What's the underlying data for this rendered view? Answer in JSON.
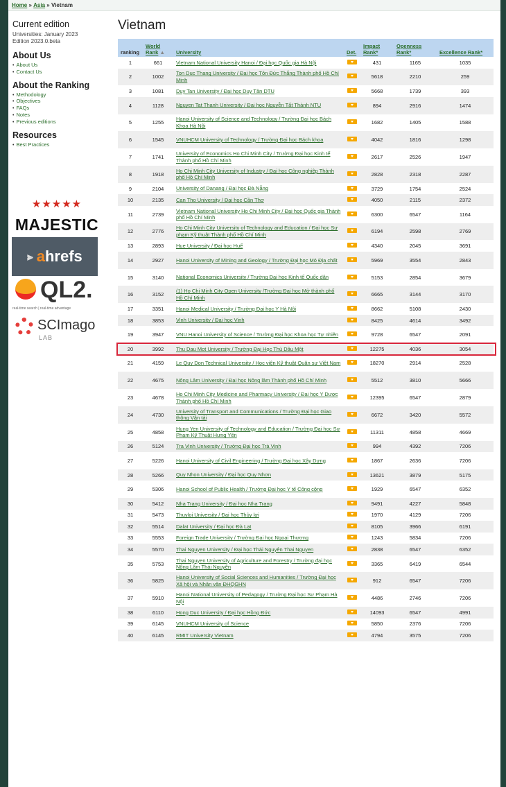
{
  "breadcrumb": {
    "home": "Home",
    "sep1": "»",
    "asia": "Asia",
    "sep2": "»",
    "current": "Vietnam"
  },
  "sidebar": {
    "current_edition": {
      "heading": "Current edition",
      "line1": "Universities: January 2023",
      "line2": "Edition 2023.0.beta"
    },
    "about_us": {
      "heading": "About Us",
      "items": [
        "About Us",
        "Contact Us"
      ]
    },
    "about_ranking": {
      "heading": "About the Ranking",
      "items": [
        "Methodology",
        "Objectives",
        "FAQs",
        "Notes",
        "Previous editions"
      ]
    },
    "resources": {
      "heading": "Resources",
      "items": [
        "Best Practices"
      ]
    }
  },
  "logos": {
    "majestic": "MAJESTIC",
    "ahrefs_a": "a",
    "ahrefs_rest": "hrefs",
    "ql2": "QL2.",
    "ql2_tagline": "real-time search | real-time advantage",
    "scimago": "SCImago",
    "scimago_lab": "LAB"
  },
  "main": {
    "title": "Vietnam",
    "columns": {
      "ranking": "ranking",
      "world_rank": "World Rank",
      "university": "University",
      "det": "Det.",
      "impact": "Impact Rank*",
      "openness": "Openness Rank*",
      "excellence": "Excellence Rank*"
    },
    "rows": [
      {
        "ranking": "1",
        "world": "661",
        "name": "Vietnam National University Hanoi / Đại học Quốc gia Hà Nội",
        "impact": "431",
        "openness": "1165",
        "excellence": "1035"
      },
      {
        "ranking": "2",
        "world": "1002",
        "name": "Ton Duc Thang University / Đại học Tôn Đức Thắng Thành phố Hồ Chí Minh",
        "impact": "5618",
        "openness": "2210",
        "excellence": "259"
      },
      {
        "ranking": "3",
        "world": "1081",
        "name": "Duy Tan University / Đại học Duy Tân DTU",
        "impact": "5668",
        "openness": "1739",
        "excellence": "393"
      },
      {
        "ranking": "4",
        "world": "1128",
        "name": "Nguyen Tat Thanh University / Đại học Nguyễn Tất Thành NTU",
        "impact": "894",
        "openness": "2916",
        "excellence": "1474"
      },
      {
        "ranking": "5",
        "world": "1255",
        "name": "Hanoi University of Science and Technology / Trường Đại học Bách Khoa Hà Nội",
        "impact": "1682",
        "openness": "1405",
        "excellence": "1588"
      },
      {
        "ranking": "6",
        "world": "1545",
        "name": "VNUHCM University of Technology / Trường Đại học Bách khoa",
        "impact": "4042",
        "openness": "1816",
        "excellence": "1298"
      },
      {
        "ranking": "7",
        "world": "1741",
        "name": "University of Economics Ho Chi Minh City / Trường Đại học Kinh tế Thành phố Hồ Chí Minh",
        "impact": "2617",
        "openness": "2526",
        "excellence": "1947"
      },
      {
        "ranking": "8",
        "world": "1918",
        "name": "Ho Chi Minh City University of Industry / Đại học Công nghiệp Thành phố Hồ Chí Minh",
        "impact": "2828",
        "openness": "2318",
        "excellence": "2287"
      },
      {
        "ranking": "9",
        "world": "2104",
        "name": "University of Danang / Đại học Đà Nẵng",
        "impact": "3729",
        "openness": "1754",
        "excellence": "2524"
      },
      {
        "ranking": "10",
        "world": "2135",
        "name": "Can Tho University / Đại học Cần Thơ",
        "impact": "4050",
        "openness": "2115",
        "excellence": "2372"
      },
      {
        "ranking": "11",
        "world": "2739",
        "name": "Vietnam National University Ho Chi Minh City / Đại học Quốc gia Thành phố Hồ Chí Minh",
        "impact": "6300",
        "openness": "6547",
        "excellence": "1164"
      },
      {
        "ranking": "12",
        "world": "2776",
        "name": "Ho Chi Minh City University of Technology and Education / Đại học Sư phạm Kỹ thuật Thành phố Hồ Chí Minh",
        "impact": "6194",
        "openness": "2598",
        "excellence": "2769"
      },
      {
        "ranking": "13",
        "world": "2893",
        "name": "Hue University / Đại học Huế",
        "impact": "4340",
        "openness": "2045",
        "excellence": "3691"
      },
      {
        "ranking": "14",
        "world": "2927",
        "name": "Hanoi University of Mining and Geology / Trường Đại học Mỏ Địa chất",
        "impact": "5969",
        "openness": "3554",
        "excellence": "2843"
      },
      {
        "ranking": "15",
        "world": "3140",
        "name": "National Economics University / Trường Đại học Kinh tế Quốc dân",
        "impact": "5153",
        "openness": "2854",
        "excellence": "3679"
      },
      {
        "ranking": "16",
        "world": "3152",
        "name": "(1) Ho Chi Minh City Open University /Trường Đại học Mở thành phố Hồ Chí Minh",
        "impact": "6665",
        "openness": "3144",
        "excellence": "3170"
      },
      {
        "ranking": "17",
        "world": "3351",
        "name": "Hanoi Medical University / Trường Đại học Y Hà Nội",
        "impact": "8662",
        "openness": "5108",
        "excellence": "2430"
      },
      {
        "ranking": "18",
        "world": "3853",
        "name": "Vinh University / Đại học Vinh",
        "impact": "8425",
        "openness": "4614",
        "excellence": "3492"
      },
      {
        "ranking": "19",
        "world": "3947",
        "name": "VNU Hanoi University of Science / Trường Đại học Khoa học Tự nhiên",
        "impact": "9728",
        "openness": "6547",
        "excellence": "2091"
      },
      {
        "ranking": "20",
        "world": "3992",
        "name": "Thu Dau Mot University / Trường Đại Học Thủ Dầu Một",
        "impact": "12275",
        "openness": "4036",
        "excellence": "3054"
      },
      {
        "ranking": "21",
        "world": "4159",
        "name": "Le Quy Don Technical University / Học viện Kỹ thuật Quân sự Việt Nam",
        "impact": "18270",
        "openness": "2914",
        "excellence": "2528"
      },
      {
        "ranking": "22",
        "world": "4675",
        "name": "Nông Lâm University / Đại học Nông lâm Thành phố Hồ Chí Minh",
        "impact": "5512",
        "openness": "3810",
        "excellence": "5666"
      },
      {
        "ranking": "23",
        "world": "4678",
        "name": "Ho Chi Minh City Medicine and Pharmacy University / Đại học Y Dược Thành phố Hồ Chí Minh",
        "impact": "12395",
        "openness": "6547",
        "excellence": "2879"
      },
      {
        "ranking": "24",
        "world": "4730",
        "name": "University of Transport and Communications / Trường Đại học Giao thông Vận tải",
        "impact": "6672",
        "openness": "3420",
        "excellence": "5572"
      },
      {
        "ranking": "25",
        "world": "4858",
        "name": "Hung Yen University of Technology and Education / Trường Đại học Sư Phạm Kỹ Thuật Hưng Yên",
        "impact": "11311",
        "openness": "4858",
        "excellence": "4669"
      },
      {
        "ranking": "26",
        "world": "5124",
        "name": "Tra Vinh University / Trường Đại học Trà Vinh",
        "impact": "994",
        "openness": "4392",
        "excellence": "7206"
      },
      {
        "ranking": "27",
        "world": "5226",
        "name": "Hanoi University of Civil Engineering / Trường Đại học Xây Dựng",
        "impact": "1867",
        "openness": "2636",
        "excellence": "7206"
      },
      {
        "ranking": "28",
        "world": "5266",
        "name": "Quy Nhon University / Đại học Quy Nhơn",
        "impact": "13621",
        "openness": "3879",
        "excellence": "5175"
      },
      {
        "ranking": "29",
        "world": "5306",
        "name": "Hanoi School of Public Health / Trường Đại học Y tế Công cộng",
        "impact": "1929",
        "openness": "6547",
        "excellence": "6352"
      },
      {
        "ranking": "30",
        "world": "5412",
        "name": "Nha Trang University / Đại học Nha Trang",
        "impact": "9491",
        "openness": "4227",
        "excellence": "5848"
      },
      {
        "ranking": "31",
        "world": "5473",
        "name": "Thuyloi University / Đại học Thủy lợi",
        "impact": "1970",
        "openness": "4129",
        "excellence": "7206"
      },
      {
        "ranking": "32",
        "world": "5514",
        "name": "Dalat University / Đại học Đà Lạt",
        "impact": "8105",
        "openness": "3966",
        "excellence": "6191"
      },
      {
        "ranking": "33",
        "world": "5553",
        "name": "Foreign Trade University / Trường Đại học Ngoại Thương",
        "impact": "1243",
        "openness": "5834",
        "excellence": "7206"
      },
      {
        "ranking": "34",
        "world": "5570",
        "name": "Thai Nguyen University / Đại học Thái Nguyên Thai Nguyen",
        "impact": "2838",
        "openness": "6547",
        "excellence": "6352"
      },
      {
        "ranking": "35",
        "world": "5753",
        "name": "Thai Nguyen University of Agriculture and Forestry / Trường đại học Nông Lâm Thái Nguyên",
        "impact": "3365",
        "openness": "6419",
        "excellence": "6544"
      },
      {
        "ranking": "36",
        "world": "5825",
        "name": "Hanoi University of Social Sciences and Humanities / Trường Đại học Xã hội và Nhân văn ĐHQGHN",
        "impact": "912",
        "openness": "6547",
        "excellence": "7206"
      },
      {
        "ranking": "37",
        "world": "5910",
        "name": "Hanoi National University of Pedagogy / Trường Đại học Sư Phạm Hà Nội",
        "impact": "4486",
        "openness": "2746",
        "excellence": "7206"
      },
      {
        "ranking": "38",
        "world": "6110",
        "name": "Hong Duc University / Đại học Hồng Đức",
        "impact": "14093",
        "openness": "6547",
        "excellence": "4991"
      },
      {
        "ranking": "39",
        "world": "6145",
        "name": "VNUHCM University of Science",
        "impact": "5850",
        "openness": "2376",
        "excellence": "7206"
      },
      {
        "ranking": "40",
        "world": "6145",
        "name": "RMIT University Vietnam",
        "impact": "4794",
        "openness": "3575",
        "excellence": "7206"
      }
    ]
  },
  "colors": {
    "highlight": "#d8263b",
    "header_bg": "#bdd6f0",
    "link": "#2b6e2b",
    "det_badge": "#f5a800"
  },
  "icons": {
    "sort": "sort-arrow-icon",
    "det": "details-icon"
  }
}
